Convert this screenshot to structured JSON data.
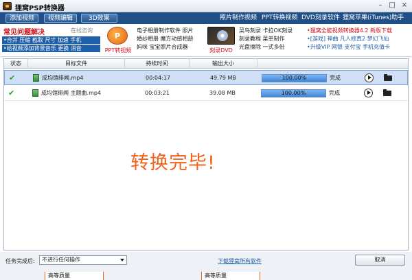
{
  "window": {
    "title": "狸窝PSP转换器",
    "minimize": "–",
    "maximize": "□",
    "close": "×"
  },
  "toolbar": {
    "tabs": [
      "添加视频",
      "视频编辑",
      "3D效果"
    ],
    "links": [
      "照片制作视频",
      "PPT转换视频",
      "DVD刻录软件",
      "狸窝苹果(iTunes)助手"
    ]
  },
  "banner": {
    "faq_title": "常见问题解决",
    "faq_consult": "在线咨询",
    "faq_lines": [
      "•合并 压缩 截取 尺寸 加速 手机",
      "•给视频添加背景音乐 更换 消音"
    ],
    "ppt_logo_text": "P",
    "ppt_label": "PPT转视频",
    "col1": [
      "电子相册制作软件 照片",
      "婚纱相册 魔方动感相册",
      "妈咪 宝宝照片合成器"
    ],
    "dvd_label": "刻录DVD",
    "col2": [
      "菜鸟刻录 卡拉OK刻录",
      "刻录教程 菜单制作",
      "光盘擦除 一式多份"
    ],
    "col3_line1": "•狸窝全能视频转换器4.2 新版下载",
    "col3_line2": "•[游戏] 神曲 凡人修真2 梦幻飞仙",
    "col3_line3": "•升级VIP 网银 支付宝 手机充值卡"
  },
  "table": {
    "headers": [
      "状态",
      "目标文件",
      "持续时间",
      "输出大小",
      ""
    ],
    "rows": [
      {
        "file": "成均馆绯闻.mp4",
        "duration": "00:04:17",
        "size": "49.79 MB",
        "progress": "100.00%",
        "progress_value": 100,
        "status": "完成"
      },
      {
        "file": "成均馆绯闻 主题曲.mp4",
        "duration": "00:03:21",
        "size": "39.08 MB",
        "progress": "100.00%",
        "progress_value": 100,
        "status": "完成"
      }
    ]
  },
  "message": "转换完毕!",
  "bottom": {
    "after_label": "任务完成后:",
    "after_value": "不进行任何操作",
    "download_link": "下载狸窝所有软件",
    "cancel": "取消",
    "quality": [
      "高等质量",
      "高等质量"
    ]
  },
  "colors": {
    "toolbar": "#1f4f86",
    "accent": "#f0621a",
    "selected_row": "#cfe0f6",
    "progress": "#3f86d8"
  }
}
